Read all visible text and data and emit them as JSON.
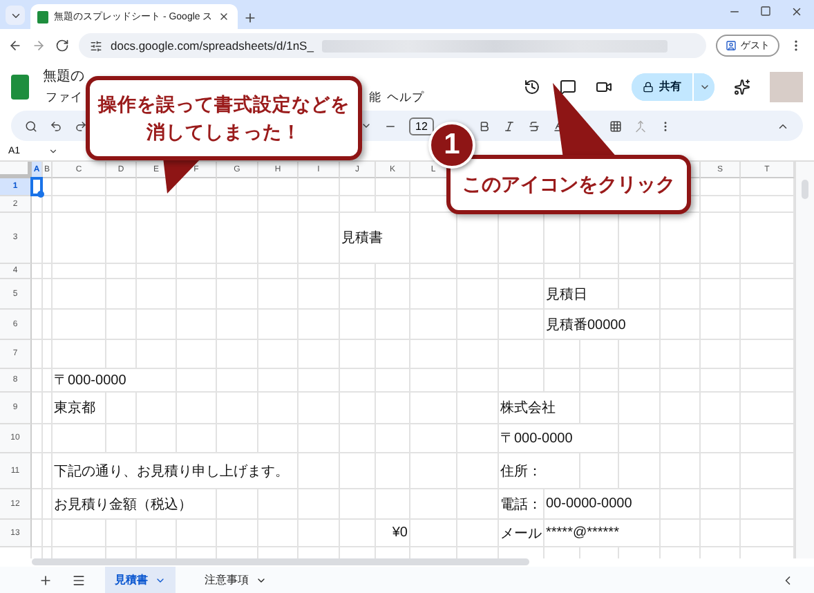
{
  "browser": {
    "tab_title": "無題のスプレッドシート - Google ス",
    "url": "docs.google.com/spreadsheets/d/1nS_",
    "profile": "ゲスト"
  },
  "doc": {
    "title": "無題の",
    "menu": [
      "ファイ",
      "能",
      "ヘルプ"
    ],
    "share": "共有"
  },
  "toolbar": {
    "font_size": "12"
  },
  "name_box": "A1",
  "columns": [
    {
      "label": "A",
      "selected": true
    },
    {
      "label": "B",
      "selected": false
    },
    {
      "label": "C",
      "selected": false
    },
    {
      "label": "D",
      "selected": false
    },
    {
      "label": "E",
      "selected": false
    },
    {
      "label": "F",
      "selected": false
    },
    {
      "label": "G",
      "selected": false
    },
    {
      "label": "H",
      "selected": false
    },
    {
      "label": "I",
      "selected": false
    },
    {
      "label": "J",
      "selected": false
    },
    {
      "label": "K",
      "selected": false
    },
    {
      "label": "L",
      "selected": false
    },
    null,
    null,
    null,
    null,
    null,
    null,
    {
      "label": "S",
      "selected": false
    },
    {
      "label": "T",
      "selected": false
    }
  ],
  "rows": [
    {
      "label": "1",
      "selected": true,
      "cells": {}
    },
    {
      "label": "2",
      "selected": false,
      "cells": {}
    },
    {
      "label": "3",
      "selected": false,
      "cells": {
        "J": {
          "text": "見積書"
        }
      }
    },
    {
      "label": "4",
      "selected": false,
      "cells": {}
    },
    {
      "label": "5",
      "selected": false,
      "cells": {
        "O": {
          "text": "見積日"
        }
      }
    },
    {
      "label": "6",
      "selected": false,
      "cells": {
        "O": {
          "text": "見積番00000"
        }
      }
    },
    {
      "label": "7",
      "selected": false,
      "cells": {}
    },
    {
      "label": "8",
      "selected": false,
      "cells": {
        "C": {
          "text": "〒000-0000"
        }
      }
    },
    {
      "label": "9",
      "selected": false,
      "cells": {
        "C": {
          "text": "東京都"
        },
        "N": {
          "text": "株式会社"
        }
      }
    },
    {
      "label": "10",
      "selected": false,
      "cells": {
        "N": {
          "text": "〒000-0000"
        }
      }
    },
    {
      "label": "11",
      "selected": false,
      "cells": {
        "C": {
          "text": "下記の通り、お見積り申し上げます。"
        },
        "N": {
          "text": "住所："
        }
      }
    },
    {
      "label": "12",
      "selected": false,
      "cells": {
        "C": {
          "text": "お見積り金額（税込）"
        },
        "N": {
          "text": "電話："
        },
        "O": {
          "text": "00-0000-0000"
        }
      }
    },
    {
      "label": "13",
      "selected": false,
      "cells": {
        "K": {
          "text": "¥0",
          "kind": "number"
        },
        "N": {
          "text": "メール"
        },
        "O": {
          "text": "*****@******"
        }
      }
    }
  ],
  "sheets": [
    {
      "label": "見積書",
      "selected": true
    },
    {
      "label": "注意事項",
      "selected": false
    }
  ],
  "callouts": [
    {
      "text": "操作を誤って書式設定などを消してしまった！"
    },
    {
      "text": "このアイコンをクリック",
      "step": "1"
    }
  ]
}
